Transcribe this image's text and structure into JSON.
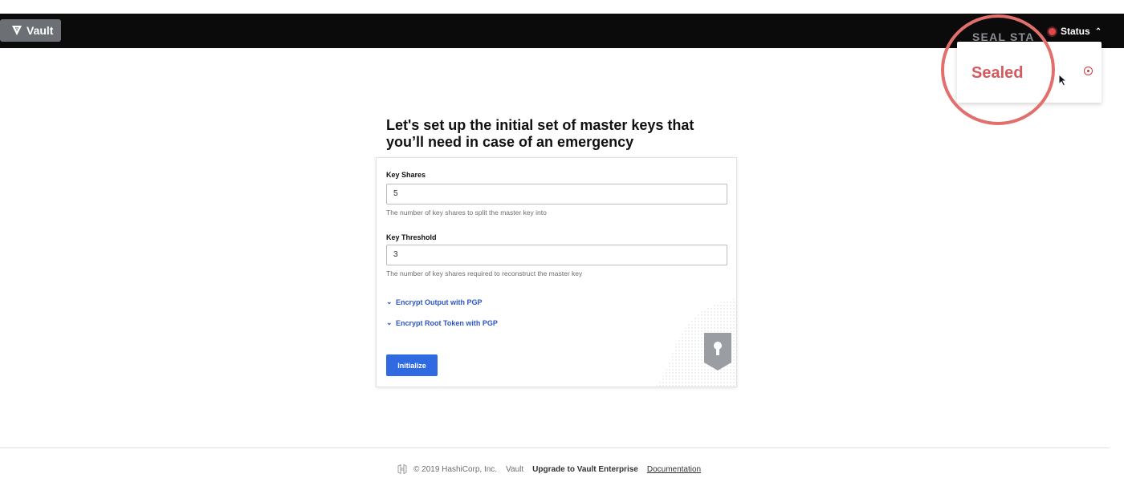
{
  "app": {
    "name": "Vault"
  },
  "navbar": {
    "status_label": "Status"
  },
  "seal_popover": {
    "caption": "SEAL STA",
    "value": "Sealed"
  },
  "init": {
    "title_line1": "Let's set up the initial set of master keys that",
    "title_line2": "you’ll need in case of an emergency",
    "key_shares": {
      "label": "Key Shares",
      "value": "5",
      "help": "The number of key shares to split the master key into"
    },
    "key_threshold": {
      "label": "Key Threshold",
      "value": "3",
      "help": "The number of key shares required to reconstruct the master key"
    },
    "toggle_pgp_output": "Encrypt Output with PGP",
    "toggle_pgp_root": "Encrypt Root Token with PGP",
    "submit_label": "Initialize"
  },
  "footer": {
    "copyright": "© 2019 HashiCorp, Inc.",
    "vault": "Vault",
    "upgrade": "Upgrade to Vault Enterprise",
    "docs": "Documentation"
  },
  "colors": {
    "navbar": "#0b0b0c",
    "brand": "#6c7075",
    "primary": "#2f6ae2",
    "link": "#2d55c8",
    "sealed": "#d55a5e",
    "highlight_ring": "#e26f6c"
  },
  "icons": [
    "vault-logo-icon",
    "status-dot-icon",
    "chevron-up-icon",
    "sealed-status-icon",
    "chevron-down-icon",
    "lock-shield-icon",
    "hashicorp-logo-icon",
    "mouse-cursor-icon"
  ]
}
